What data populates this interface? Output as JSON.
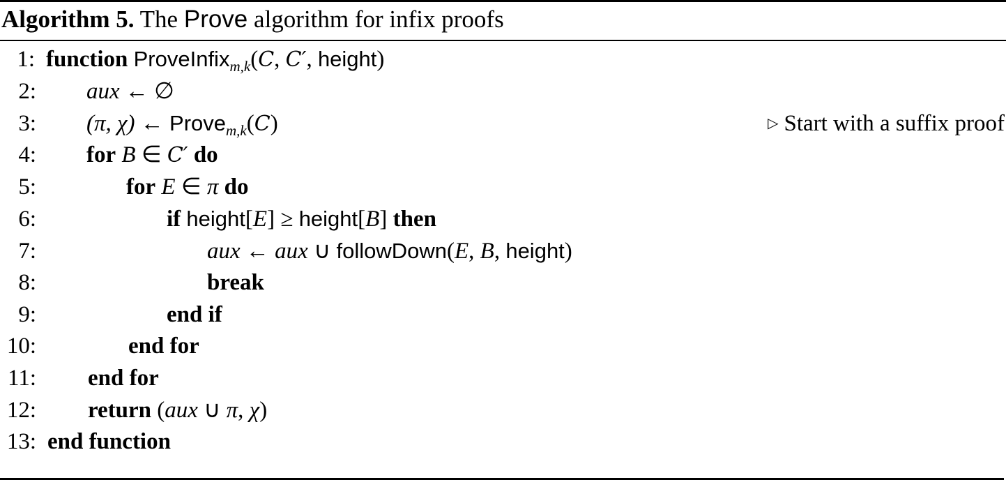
{
  "caption": {
    "label": "Algorithm 5.",
    "text_before": "The",
    "name": "Prove",
    "text_after": "algorithm for infix proofs"
  },
  "symbols": {
    "assign": "←",
    "in": "∈",
    "union": "∪",
    "geq": "≥",
    "emptyset": "∅",
    "comment_marker": "▷"
  },
  "lines": [
    {
      "num": "1:",
      "kw1": "function",
      "fn": "ProveInfix",
      "sub": "m,k",
      "args_open": "(",
      "arg1": "C",
      "sep1": ", ",
      "arg2": "C′",
      "sep2": ", ",
      "arg3": "height",
      "args_close": ")"
    },
    {
      "num": "2:",
      "lhs": "aux",
      "op": "←",
      "rhs": "∅"
    },
    {
      "num": "3:",
      "lhs": "(π, χ)",
      "op": "←",
      "fn": "Prove",
      "sub": "m,k",
      "arg_open": "(",
      "arg": "C",
      "arg_close": ")",
      "comment": "Start with a suffix proof"
    },
    {
      "num": "4:",
      "kw1": "for",
      "var": "B",
      "op": "∈",
      "set": "C′",
      "kw2": "do"
    },
    {
      "num": "5:",
      "kw1": "for",
      "var": "E",
      "op": "∈",
      "set": "π",
      "kw2": "do"
    },
    {
      "num": "6:",
      "kw1": "if",
      "f1": "height",
      "a1": "E",
      "op": "≥",
      "f2": "height",
      "a2": "B",
      "kw2": "then"
    },
    {
      "num": "7:",
      "lhs": "aux",
      "op": "←",
      "rhs": "aux",
      "op2": "∪",
      "fn": "followDown",
      "args_open": "(",
      "a1": "E",
      "a2": "B",
      "a3": "height",
      "args_close": ")"
    },
    {
      "num": "8:",
      "kw1": "break"
    },
    {
      "num": "9:",
      "kw1": "end if"
    },
    {
      "num": "10:",
      "kw1": "end for"
    },
    {
      "num": "11:",
      "kw1": "end for"
    },
    {
      "num": "12:",
      "kw1": "return",
      "expr_open": "(",
      "e1": "aux",
      "op": "∪",
      "e2": "π",
      "sep": ", ",
      "e3": "χ",
      "expr_close": ")"
    },
    {
      "num": "13:",
      "kw1": "end function"
    }
  ]
}
